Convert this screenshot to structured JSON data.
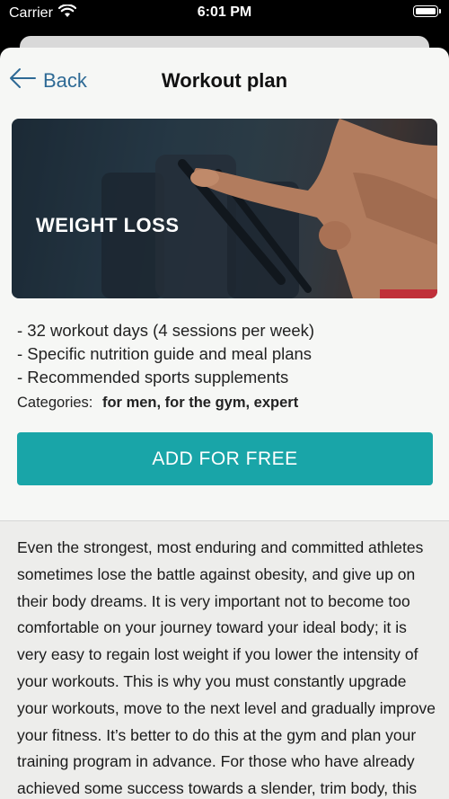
{
  "status_bar": {
    "carrier": "Carrier",
    "time": "6:01 PM",
    "icons": [
      "wifi-icon",
      "battery-icon"
    ]
  },
  "nav": {
    "back_label": "Back",
    "title": "Workout plan"
  },
  "hero": {
    "label": "WEIGHT LOSS"
  },
  "features": [
    "- 32 workout days (4 sessions per week)",
    "- Specific nutrition guide and meal plans",
    "- Recommended sports supplements"
  ],
  "categories": {
    "label": "Categories:",
    "values": "for men, for the gym, expert"
  },
  "cta": {
    "label": "ADD FOR FREE"
  },
  "description": "Even the strongest, most enduring and committed athletes sometimes lose the battle against obesity, and give up on their body dreams. It is very important not to become too comfortable on your journey toward your ideal body; it is very easy to regain lost weight if you lower the intensity of your workouts. This is why you must constantly upgrade your workouts, move to the next level and gradually improve your fitness. It’s better to do this at the gym and plan your training program in advance. For those who have already achieved some success towards a slender, trim body, this program kit,",
  "colors": {
    "accent": "#19a5a8",
    "link": "#2e6a95",
    "sheet_bg": "#f6f7f5",
    "description_bg": "#ededeb"
  }
}
